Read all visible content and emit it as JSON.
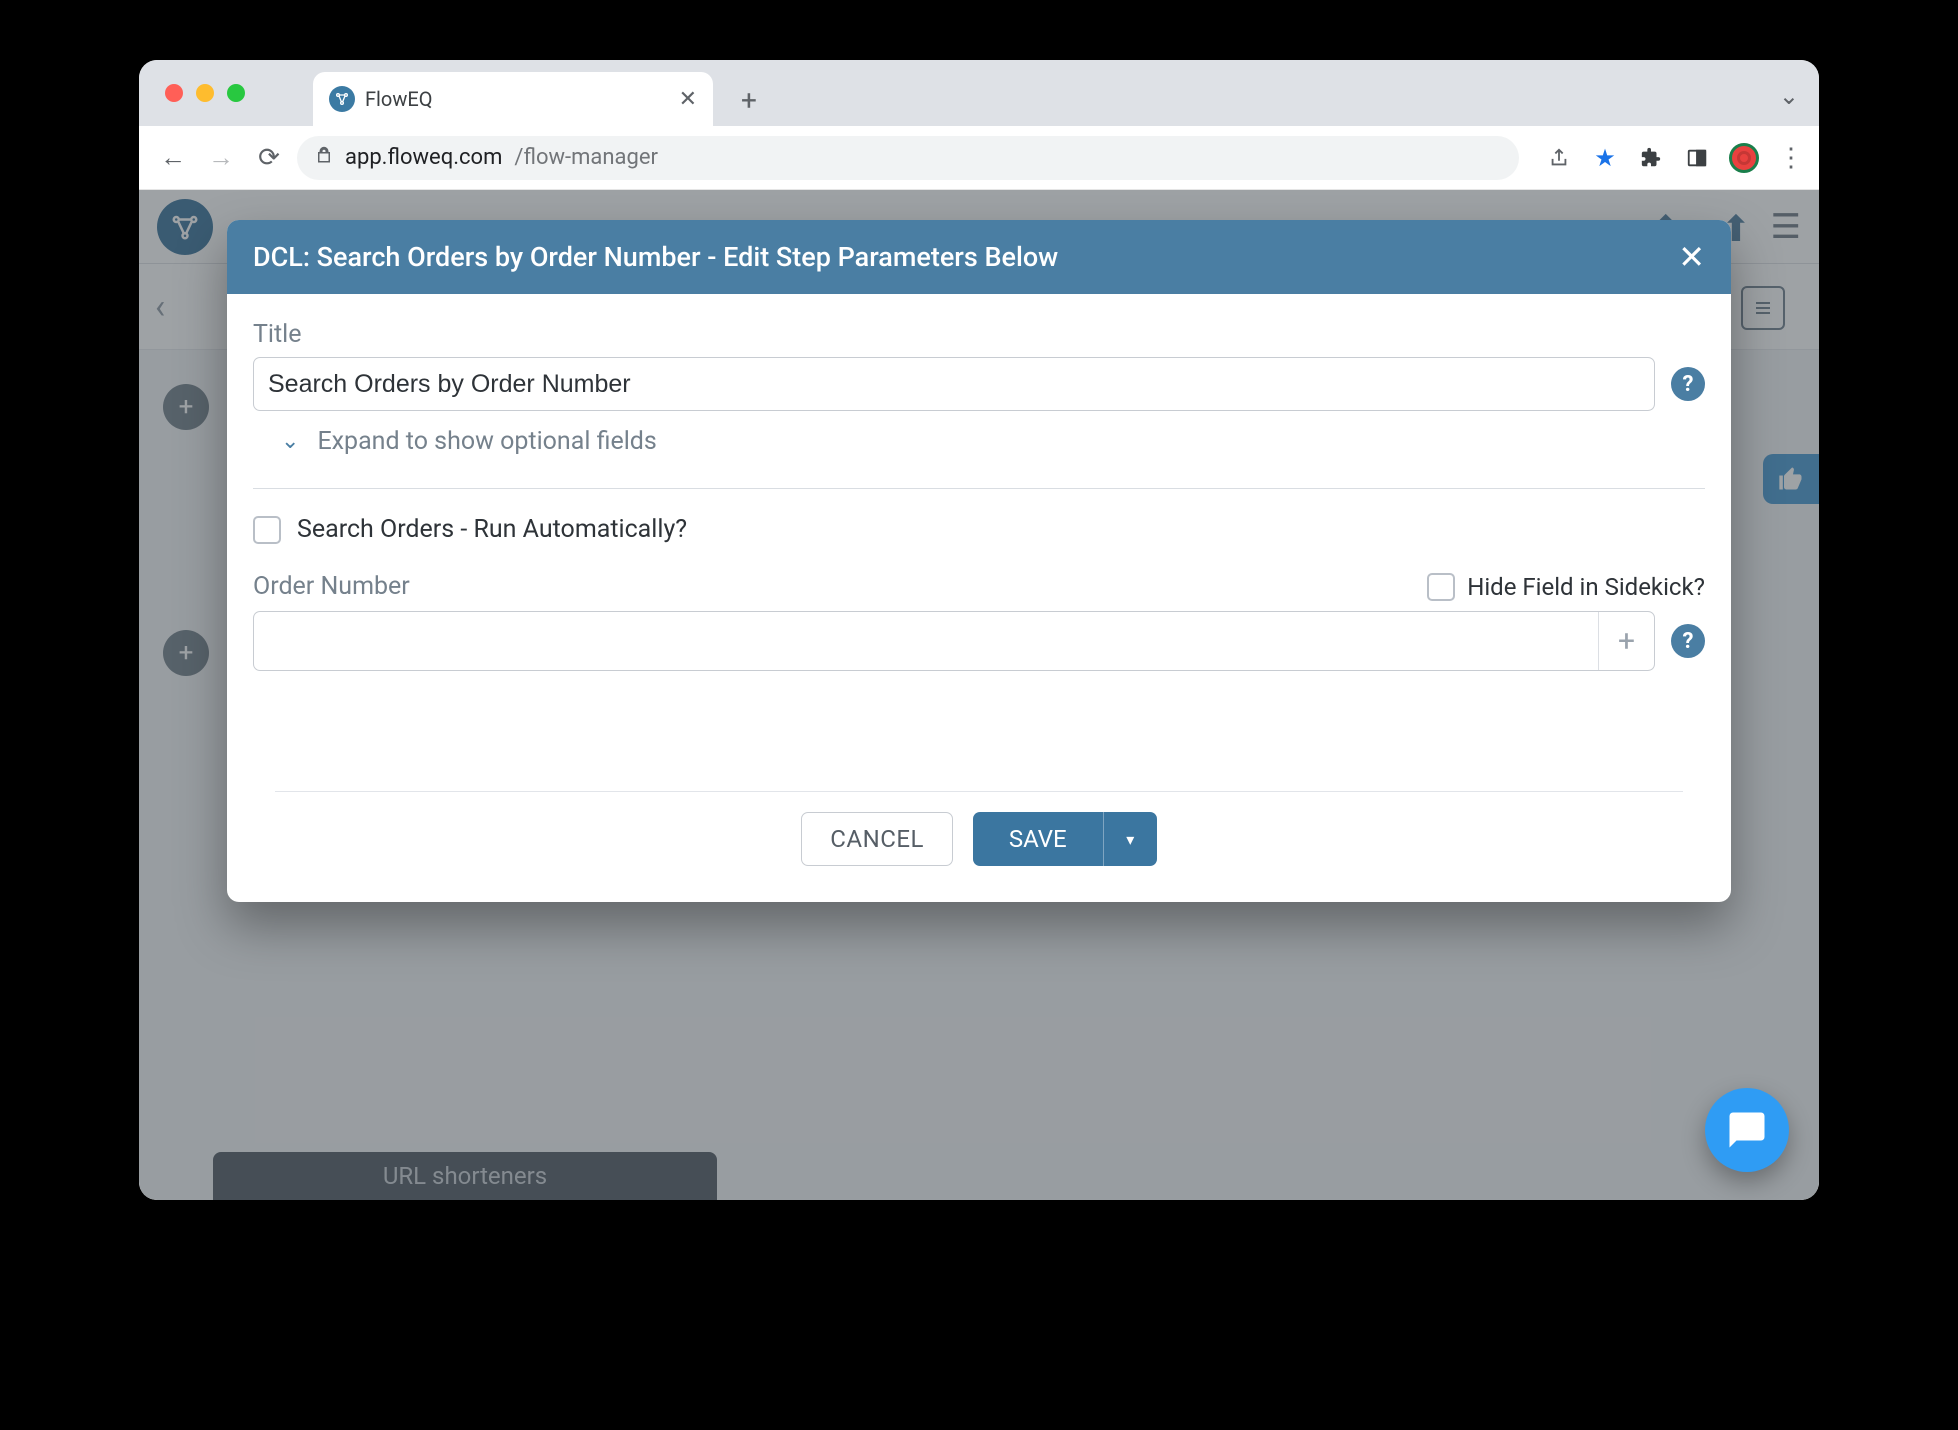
{
  "browser": {
    "tab_title": "FlowEQ",
    "url_domain": "app.floweq.com",
    "url_path": "/flow-manager"
  },
  "app": {
    "footer_chip": "URL shorteners"
  },
  "modal": {
    "header": "DCL: Search Orders by Order Number - Edit Step Parameters Below",
    "title_label": "Title",
    "title_value": "Search Orders by Order Number",
    "expand_label": "Expand to show optional fields",
    "run_auto_label": "Search Orders - Run Automatically?",
    "order_number_label": "Order Number",
    "hide_field_label": "Hide Field in Sidekick?",
    "order_number_value": "",
    "cancel_label": "CANCEL",
    "save_label": "SAVE"
  }
}
